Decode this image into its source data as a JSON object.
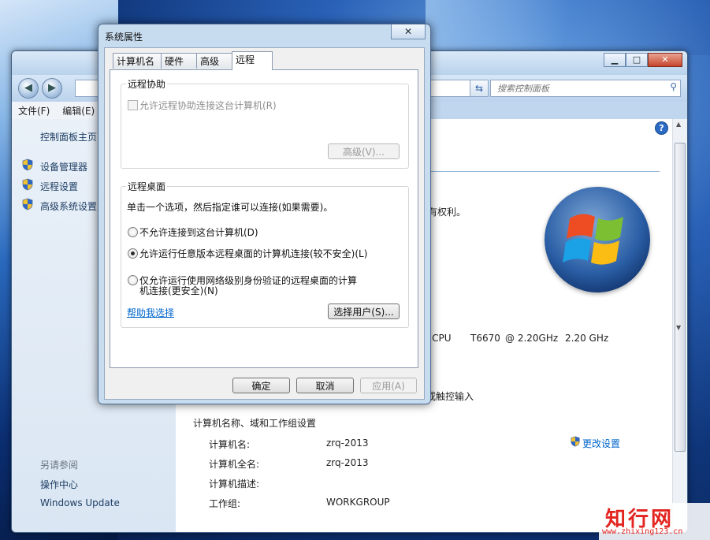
{
  "background_window": {
    "search_placeholder": "搜索控制面板",
    "menu": [
      "文件(F)",
      "编辑(E)"
    ],
    "sidebar": {
      "home": "控制面板主页",
      "links": [
        "设备管理器",
        "远程设置",
        "高级系统设置"
      ],
      "see_also_title": "另请参阅",
      "see_also": [
        "操作中心",
        "Windows Update"
      ]
    },
    "content": {
      "rights_tail": "有权利。",
      "cpu_parts": [
        "o CPU",
        "T6670",
        "@ 2.20GHz",
        "2.20 GHz"
      ],
      "touch_tail": "或触控输入",
      "section_title": "计算机名称、域和工作组设置",
      "change_settings": "更改设置",
      "rows": [
        {
          "label": "计算机名:",
          "value": "zrq-2013"
        },
        {
          "label": "计算机全名:",
          "value": "zrq-2013"
        },
        {
          "label": "计算机描述:",
          "value": ""
        },
        {
          "label": "工作组:",
          "value": "WORKGROUP"
        }
      ]
    }
  },
  "dialog": {
    "title": "系统属性",
    "tabs": [
      "计算机名",
      "硬件",
      "高级",
      "远程"
    ],
    "remote_assist": {
      "group": "远程协助",
      "checkbox": "允许远程协助连接这台计算机(R)",
      "advanced_button": "高级(V)..."
    },
    "remote_desktop": {
      "group": "远程桌面",
      "instruction": "单击一个选项，然后指定谁可以连接(如果需要)。",
      "options": [
        "不允许连接到这台计算机(D)",
        "允许运行任意版本远程桌面的计算机连接(较不安全)(L)",
        "仅允许运行使用网络级别身份验证的远程桌面的计算",
        "机连接(更安全)(N)"
      ],
      "selected_index": 1,
      "help_link": "帮助我选择",
      "select_users_button": "选择用户(S)..."
    },
    "buttons": {
      "ok": "确定",
      "cancel": "取消",
      "apply": "应用(A)"
    }
  },
  "watermark": {
    "cn": "知行网",
    "url": "www.zhixing123.cn"
  },
  "colors": {
    "link": "#0066cc",
    "accent": "#2b6bc4",
    "watermark": "#e3231f"
  }
}
